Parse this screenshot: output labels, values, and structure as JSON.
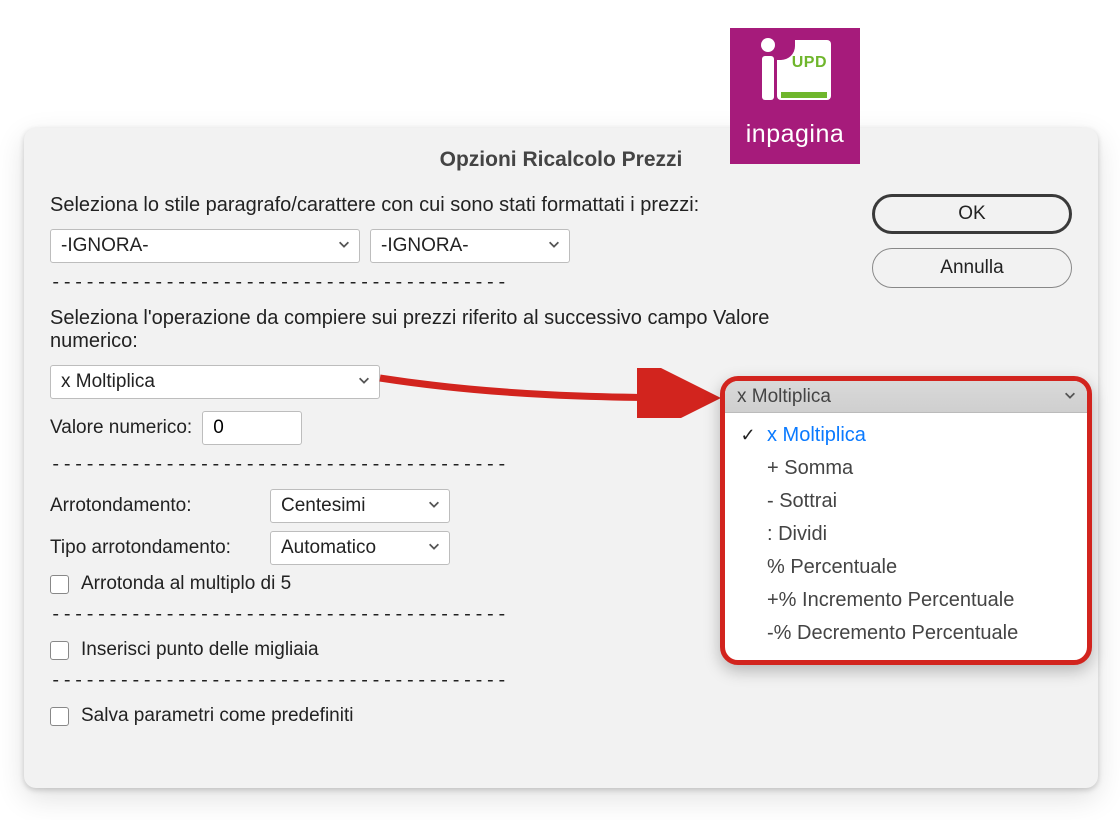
{
  "logo": {
    "brand": "inpagina",
    "badge": "UPD"
  },
  "dialog": {
    "title": "Opzioni Ricalcolo Prezzi",
    "buttons": {
      "ok": "OK",
      "cancel": "Annulla"
    },
    "style_prompt": "Seleziona lo stile paragrafo/carattere con cui sono stati formattati i prezzi:",
    "paragraph_style_selected": "-IGNORA-",
    "char_style_selected": "-IGNORA-",
    "separator": "----------------------------------------",
    "operation_prompt": "Seleziona l'operazione da compiere sui prezzi riferito al successivo campo Valore numerico:",
    "operation_selected": "x Moltiplica",
    "numeric_label": "Valore numerico:",
    "numeric_value": "0",
    "rounding_label": "Arrotondamento:",
    "rounding_selected": "Centesimi",
    "rounding_type_label": "Tipo arrotondamento:",
    "rounding_type_selected": "Automatico",
    "round_to_5": "Arrotonda al multiplo di 5",
    "thousands": "Inserisci punto delle migliaia",
    "save_defaults": "Salva parametri come predefiniti"
  },
  "popout": {
    "header": "x Moltiplica",
    "items": [
      {
        "label": "x Moltiplica",
        "selected": true
      },
      {
        "label": "+ Somma",
        "selected": false
      },
      {
        "label": "- Sottrai",
        "selected": false
      },
      {
        "label": ": Dividi",
        "selected": false
      },
      {
        "label": "% Percentuale",
        "selected": false
      },
      {
        "label": "+% Incremento Percentuale",
        "selected": false
      },
      {
        "label": "-% Decremento Percentuale",
        "selected": false
      }
    ]
  }
}
